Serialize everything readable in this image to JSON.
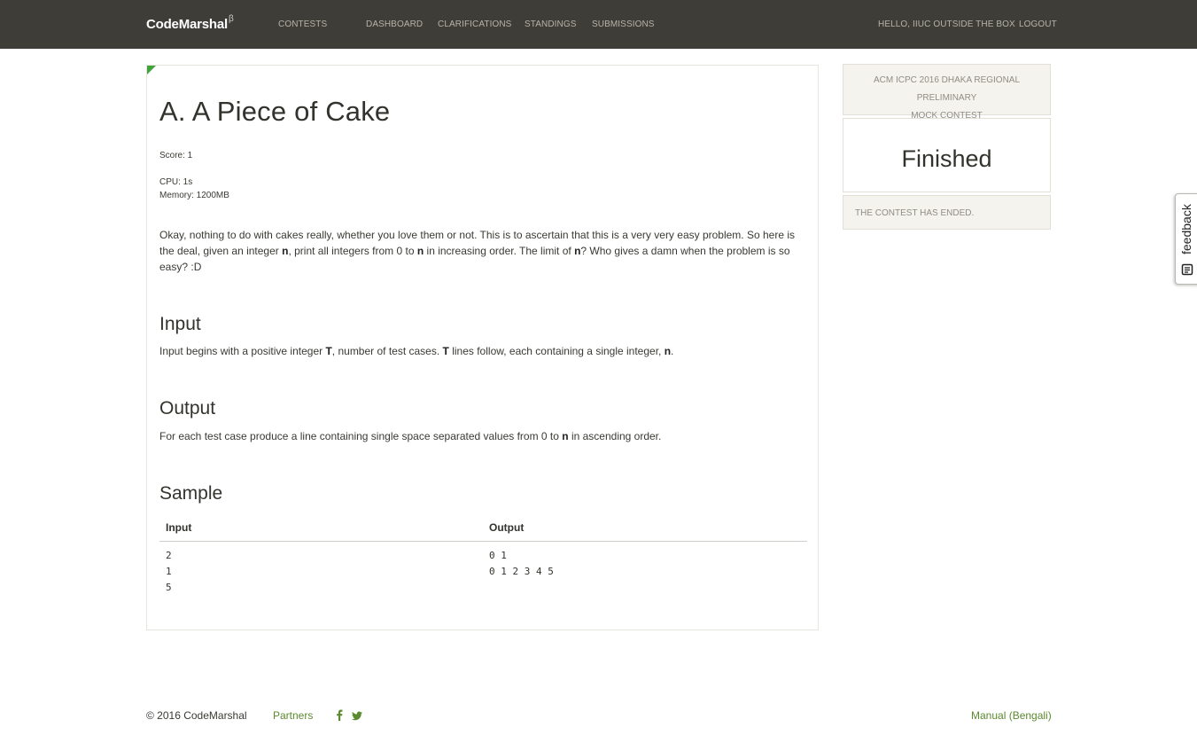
{
  "header": {
    "brand": "CodeMarshal",
    "brand_sup": "β",
    "nav": {
      "contests": "CONTESTS",
      "dashboard": "DASHBOARD",
      "clarifications": "CLARIFICATIONS",
      "standings": "STANDINGS",
      "submissions": "SUBMISSIONS"
    },
    "greeting": "HELLO, IIUC OUTSIDE THE BOX",
    "logout": "LOGOUT"
  },
  "problem": {
    "title": "A. A Piece of Cake",
    "score": "Score: 1",
    "cpu": "CPU: 1s",
    "memory": "Memory: 1200MB",
    "description": {
      "p1": "Okay, nothing to do with cakes really, whether you love them or not. This is to ascertain that this is a very very easy problem. So here is the deal, given an integer ",
      "n1": "n",
      "p2": ", print all integers from 0 to ",
      "n2": "n",
      "p3": " in increasing order. The limit of ",
      "n3": "n",
      "p4": "? Who gives a damn when the problem is so easy? :D"
    },
    "input": {
      "heading": "Input",
      "p1": "Input begins with a positive integer ",
      "t1": "T",
      "p2": ", number of test cases. ",
      "t2": "T",
      "p3": " lines follow, each containing a single integer, ",
      "n": "n",
      "p4": "."
    },
    "output": {
      "heading": "Output",
      "p1": "For each test case produce a line containing single space separated values from 0 to ",
      "n": "n",
      "p2": " in ascending order."
    },
    "sample": {
      "heading": "Sample",
      "input_header": "Input",
      "output_header": "Output",
      "input_lines": [
        "2",
        "1",
        "5"
      ],
      "output_lines": [
        "0 1",
        "0 1 2 3 4 5"
      ]
    }
  },
  "sidebar": {
    "contest_name_line1": "ACM ICPC 2016 DHAKA REGIONAL PRELIMINARY",
    "contest_name_line2": "MOCK CONTEST",
    "status": "Finished",
    "ended": "THE CONTEST HAS ENDED."
  },
  "feedback": {
    "label": "feedback"
  },
  "footer": {
    "copyright": "© 2016 CodeMarshal",
    "partners": "Partners",
    "manual": "Manual (Bengali)",
    "social_icons": [
      "facebook-icon",
      "twitter-icon"
    ]
  },
  "colors": {
    "topbar": "#3e3d37",
    "accent_green": "#41a33a",
    "link_green": "#5b8a2f",
    "sidebar_bg": "#f5f3ee"
  }
}
